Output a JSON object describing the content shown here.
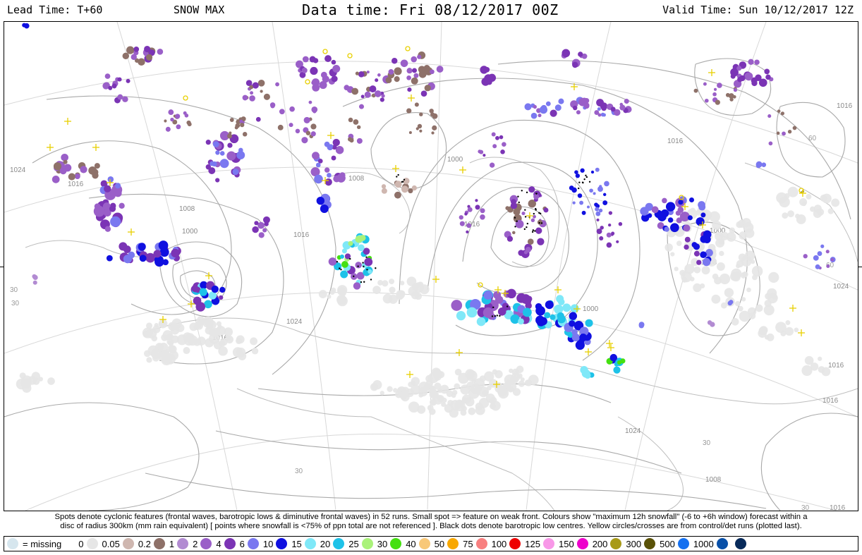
{
  "header": {
    "lead_time": "Lead Time: T+60",
    "product": "SNOW MAX",
    "data_time": "Data time:  Fri 08/12/2017 00Z",
    "valid_time": "Valid Time: Sun 10/12/2017 12Z"
  },
  "caption": {
    "line1": "Spots denote cyclonic features (frontal waves, barotropic lows & diminutive frontal waves) in 52 runs. Small spot => feature on weak front. Colours show \"maximum 12h snowfall\" (-6 to +6h window) forecast within a",
    "line2": "disc of radius 300km (mm rain equivalent) [ points where snowfall is <75% of ppn total are not referenced ]. Black dots denote barotropic low centres. Yellow circles/crosses are from control/det runs (plotted last)."
  },
  "legend": {
    "missing_label": "= missing",
    "missing_color": "#d6e6ee",
    "items": [
      {
        "label": "0",
        "color": "#e6e6e6"
      },
      {
        "label": "0.05",
        "color": "#cfb7b0"
      },
      {
        "label": "0.2",
        "color": "#8e7169"
      },
      {
        "label": "1",
        "color": "#b28bd2"
      },
      {
        "label": "2",
        "color": "#9a5fc8"
      },
      {
        "label": "4",
        "color": "#7b34b5"
      },
      {
        "label": "6",
        "color": "#7a78f0"
      },
      {
        "label": "10",
        "color": "#1010e0"
      },
      {
        "label": "15",
        "color": "#7fe8f8"
      },
      {
        "label": "20",
        "color": "#1ec2e8"
      },
      {
        "label": "25",
        "color": "#aaf27a"
      },
      {
        "label": "30",
        "color": "#44e010"
      },
      {
        "label": "40",
        "color": "#f8c878"
      },
      {
        "label": "50",
        "color": "#f8a800"
      },
      {
        "label": "75",
        "color": "#f88080"
      },
      {
        "label": "100",
        "color": "#ee0000"
      },
      {
        "label": "125",
        "color": "#f898e8"
      },
      {
        "label": "150",
        "color": "#ee00cc"
      },
      {
        "label": "200",
        "color": "#a89a18"
      },
      {
        "label": "300",
        "color": "#5a5208"
      },
      {
        "label": "500",
        "color": "#1470f0"
      },
      {
        "label": "1000",
        "color": "#0850a8"
      },
      {
        "label": "",
        "color": "#082a5a"
      }
    ]
  },
  "isobar_labels": [
    "1024",
    "1016",
    "1008",
    "1000",
    "1016",
    "1008",
    "1000",
    "1016",
    "1024",
    "1016",
    "1016",
    "1008",
    "1000",
    "1016",
    "1024",
    "1008",
    "1000",
    "1016",
    "1024",
    "1016",
    "1008",
    "1016"
  ],
  "lat_labels": [
    "30",
    "30",
    "60",
    "60",
    "30",
    "30",
    "30"
  ]
}
